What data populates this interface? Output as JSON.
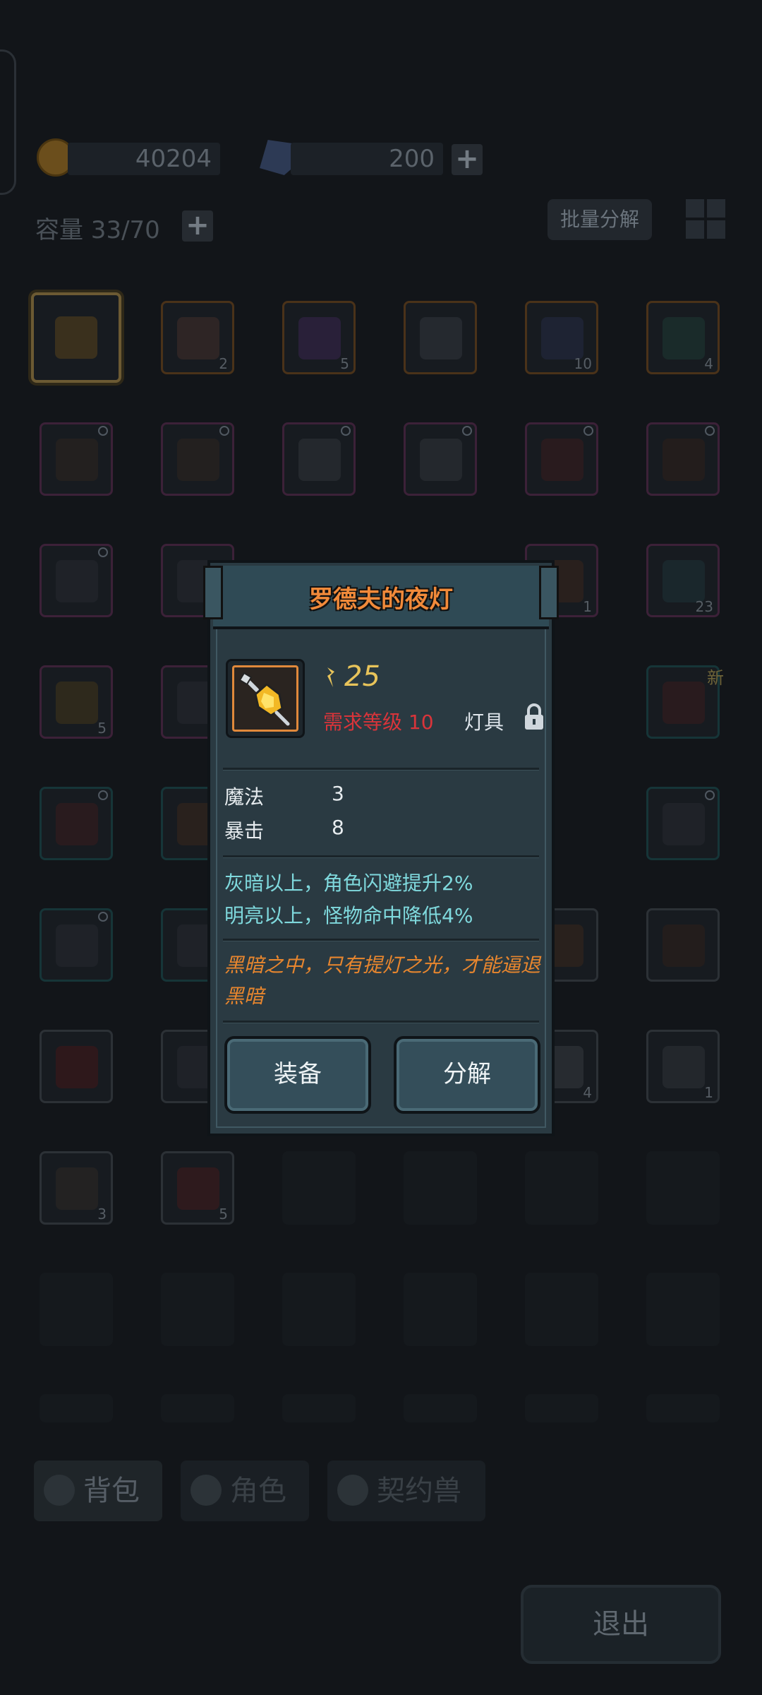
{
  "currency": {
    "gold": "40204",
    "crystals": "200"
  },
  "inventory": {
    "capacity_label": "容量 33/70",
    "batch_decompose_label": "批量分解",
    "new_badge": "新",
    "counts": [
      "2",
      "5",
      "10",
      "4",
      "1",
      "23",
      "5",
      "4",
      "1",
      "3",
      "5"
    ]
  },
  "tabs": {
    "backpack": "背包",
    "character": "角色",
    "pet": "契约兽"
  },
  "exit_label": "退出",
  "item_popup": {
    "title": "罗德夫的夜灯",
    "power": "25",
    "required_level": "需求等级 10",
    "item_type": "灯具",
    "stats": [
      {
        "name": "魔法",
        "value": "3"
      },
      {
        "name": "暴击",
        "value": "8"
      }
    ],
    "effects": [
      "灰暗以上，角色闪避提升2%",
      "明亮以上，怪物命中降低4%"
    ],
    "flavor_text": "黑暗之中，只有提灯之光，才能逼退黑暗",
    "equip_label": "装备",
    "decompose_label": "分解"
  },
  "colors": {
    "title_orange": "#f18a3a",
    "required_level_red": "#d9343a",
    "effect_cyan": "#7fd9dd",
    "flavor_orange": "#e8862e",
    "power_gold": "#e8c45a"
  }
}
